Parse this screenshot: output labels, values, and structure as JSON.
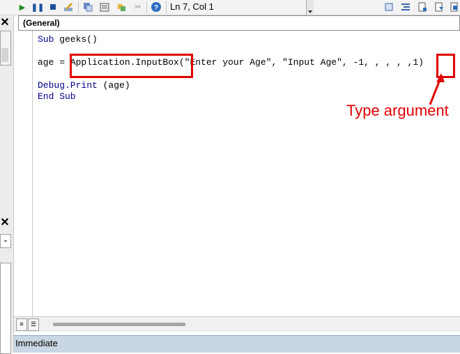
{
  "toolbar": {
    "status": "Ln 7, Col 1",
    "icons": [
      "run-icon",
      "break-icon",
      "reset-icon",
      "design-mode-icon",
      "project-explorer-icon",
      "properties-icon",
      "object-browser-icon",
      "toolbox-icon",
      "help-icon"
    ]
  },
  "code_window": {
    "procedure_dropdown": "(General)",
    "lines": {
      "line1_kw": "Sub",
      "line1_rest": " geeks()",
      "line2_pre": "age = ",
      "line2_call": "Application.InputBox",
      "line2_args": "(\"Enter your Age\", \"Input Age\", -1, , , , ,",
      "line2_type": "1",
      "line2_end": ")",
      "line3_kw": "Debug.Print",
      "line3_rest": " (age)",
      "line4": "End Sub"
    }
  },
  "annotation": {
    "text": "Type argument",
    "color": "#e00000"
  },
  "immediate": {
    "label": "Immediate"
  }
}
